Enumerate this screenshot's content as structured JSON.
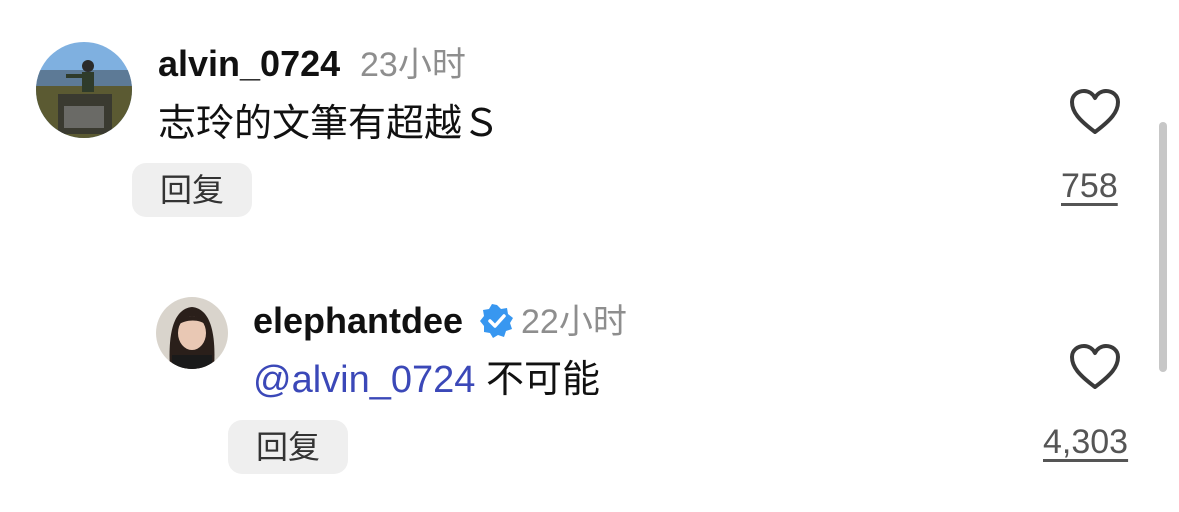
{
  "comments": [
    {
      "username": "alvin_0724",
      "time": "23小时",
      "text": "志玲的文筆有超越Ｓ",
      "reply_label": "回复",
      "likes": "758",
      "verified": false
    },
    {
      "username": "elephantdee",
      "time": "22小时",
      "mention": "@alvin_0724",
      "text": " 不可能",
      "reply_label": "回复",
      "likes": "4,303",
      "verified": true
    }
  ],
  "colors": {
    "mention": "#3b48b8",
    "verified_badge": "#3897f0",
    "timestamp": "#8e8e8e",
    "reply_bg": "#efefef"
  },
  "icons": [
    "heart-icon",
    "verified-badge-icon"
  ]
}
